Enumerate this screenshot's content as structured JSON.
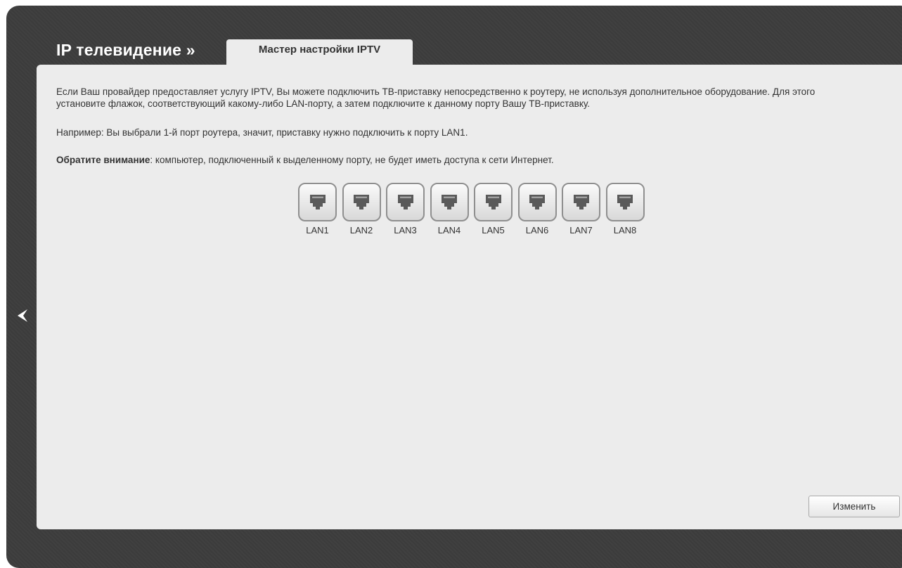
{
  "header": {
    "title": "IP телевидение »",
    "tab_label": "Мастер настройки IPTV"
  },
  "content": {
    "description": "Если Ваш провайдер предоставляет услугу IPTV, Вы можете подключить ТВ-приставку непосредственно к роутеру, не используя дополнительное оборудование. Для этого установите флажок, соответствующий какому-либо LAN-порту, а затем подключите к данному порту Вашу ТВ-приставку.",
    "example": "Например: Вы выбрали 1-й порт роутера, значит, приставку нужно подключить к порту LAN1.",
    "notice_label": "Обратите внимание",
    "notice_text": ": компьютер, подключенный к выделенному порту, не будет иметь доступа к сети Интернет."
  },
  "ports": [
    {
      "label": "LAN1",
      "icon": "ethernet-port-icon",
      "selected": false
    },
    {
      "label": "LAN2",
      "icon": "ethernet-port-icon",
      "selected": false
    },
    {
      "label": "LAN3",
      "icon": "ethernet-port-icon",
      "selected": false
    },
    {
      "label": "LAN4",
      "icon": "ethernet-port-icon",
      "selected": false
    },
    {
      "label": "LAN5",
      "icon": "ethernet-port-icon",
      "selected": false
    },
    {
      "label": "LAN6",
      "icon": "ethernet-port-icon",
      "selected": false
    },
    {
      "label": "LAN7",
      "icon": "ethernet-port-icon",
      "selected": false
    },
    {
      "label": "LAN8",
      "icon": "ethernet-port-icon",
      "selected": false
    }
  ],
  "actions": {
    "edit_label": "Изменить"
  },
  "nav": {
    "back_icon": "chevron-left-icon"
  },
  "colors": {
    "frame": "#3d3d3d",
    "panel": "#ececec",
    "text": "#333333"
  }
}
